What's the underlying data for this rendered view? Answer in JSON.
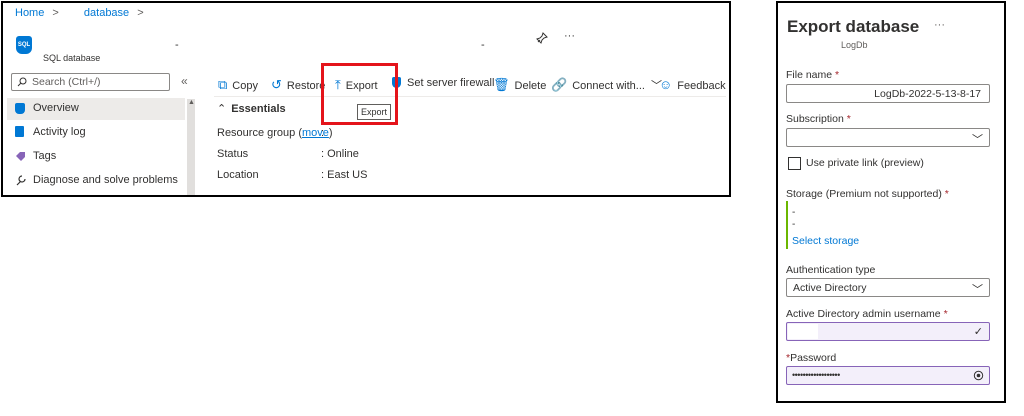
{
  "breadcrumb": {
    "home": "Home",
    "sep": ">",
    "current": "database"
  },
  "resource": {
    "type": "SQL database",
    "icon_text": "SQL",
    "name_mark1": "-",
    "name_mark2": "-"
  },
  "header_icons": {
    "pin": "pin-icon",
    "more": "···"
  },
  "sidebar": {
    "search_placeholder": "Search (Ctrl+/)",
    "collapse": "«",
    "items": [
      {
        "label": "Overview",
        "icon": "sql-icon",
        "selected": true
      },
      {
        "label": "Activity log",
        "icon": "activity-log-icon"
      },
      {
        "label": "Tags",
        "icon": "tag-icon"
      },
      {
        "label": "Diagnose and solve problems",
        "icon": "wrench-icon"
      }
    ]
  },
  "toolbar": {
    "copy": "Copy",
    "restore": "Restore",
    "export": "Export",
    "firewall": "Set server firewall",
    "delete": "Delete",
    "connect": "Connect with...",
    "feedback": "Feedback"
  },
  "tooltip": "Export",
  "essentials": {
    "heading": "Essentials",
    "rows": [
      {
        "label": "Resource group (",
        "link": "move",
        "label_end": ")",
        "value": ":"
      },
      {
        "label": "Status",
        "value": ": Online"
      },
      {
        "label": "Location",
        "value": ": East US"
      }
    ]
  },
  "export_panel": {
    "title": "Export database",
    "more": "···",
    "subtitle": "LogDb",
    "file_name_label": "File name",
    "file_name_value": "LogDb-2022-5-13-8-17",
    "subscription_label": "Subscription",
    "subscription_value": "",
    "private_link_label": "Use private link (preview)",
    "storage_label": "Storage (Premium not supported)",
    "storage_line1": "-",
    "storage_line2": "-",
    "select_storage": "Select storage",
    "auth_label": "Authentication type",
    "auth_value": "Active Directory",
    "admin_label": "Active Directory admin username",
    "admin_value": "",
    "password_label": "Password",
    "password_value": "••••••••••••••••••",
    "required": "*"
  },
  "colors": {
    "accent": "#0078d4",
    "highlight": "#e4141b",
    "validated": "#8764b8",
    "storage_bar": "#6bb700"
  }
}
